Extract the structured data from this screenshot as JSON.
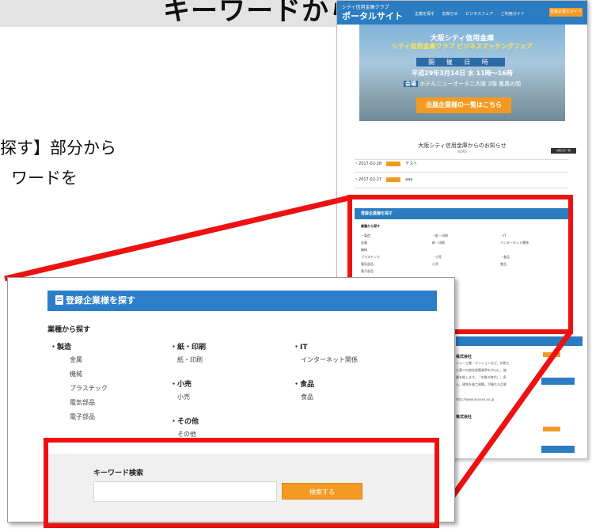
{
  "title_band": {
    "text": "キーワードから検索す"
  },
  "instructions": {
    "line1": "探す】部分から",
    "line2": "ワードを"
  },
  "site": {
    "org": "シティ信用金庫クラブ",
    "portal": "ポータルサイト",
    "nav": [
      "企業を探す",
      "お知らせ",
      "ビジネスフェア",
      "ご利用ガイド"
    ],
    "guide_button": "登録企業のガイド",
    "hero": {
      "line1": "大阪シティ信用金庫",
      "line2": "シティ信用金庫クラブ ビジネスマッチングフェア",
      "date_label": "開 催 日 時",
      "date": "平成29年3月14日 水 11時～16時",
      "venue_tag": "会場",
      "venue": "ホテルニューオータニ大阪 2階 鳳凰の間",
      "cta": "出展企業様の一覧はこちら"
    },
    "news_title": "大阪シティ信用金庫からのお知らせ",
    "news_sub": "NEWS",
    "news_more": "お知らせ一覧",
    "news": [
      {
        "date": "2017-02-28",
        "text": "テスト"
      },
      {
        "date": "2017-02-27",
        "text": "aaa"
      }
    ],
    "mini_panel": {
      "title": "登録企業様を探す",
      "sub": "業種から探す",
      "col1": [
        "・製造",
        "金属",
        "機械",
        "プラスチック",
        "電気部品",
        "電子部品"
      ],
      "col2": [
        "・紙・印刷",
        "紙・印刷",
        "",
        "・小売",
        "小売"
      ],
      "col3": [
        "・IT",
        "インターネット関係",
        "",
        "・食品",
        "食品"
      ]
    },
    "biz": {
      "name1": "株式会社",
      "text1": [
        "ニュー工業・マンションなど、技術工",
        "工事での総合設備業界を中心に、施",
        "業を推します。「本質の時代」、多",
        "ん。建物を施工建築。が軸れる品質"
      ],
      "url": "http://www.xxxxxx.xx.jp",
      "btn": "詳細を表示する",
      "name2": "株式会社"
    }
  },
  "zoom": {
    "title": "登録企業様を探す",
    "section": "業種から探す",
    "col1": {
      "cat": "・製造",
      "items": [
        "金属",
        "機械",
        "プラスチック",
        "電気部品",
        "電子部品"
      ]
    },
    "col2": {
      "cat1": "・紙・印刷",
      "items1": [
        "紙・印刷"
      ],
      "cat2": "・小売",
      "items2": [
        "小売"
      ],
      "cat3": "・その他",
      "items3": [
        "その他"
      ]
    },
    "col3": {
      "cat1": "・IT",
      "items1": [
        "インターネット関係"
      ],
      "cat2": "・食品",
      "items2": [
        "食品"
      ]
    },
    "keyword_label": "キーワード検索",
    "keyword_placeholder": "",
    "search_button": "検索する"
  },
  "colors": {
    "primary_blue": "#2c7ec8",
    "accent_orange": "#f49a23",
    "highlight_red": "#ee1111"
  }
}
